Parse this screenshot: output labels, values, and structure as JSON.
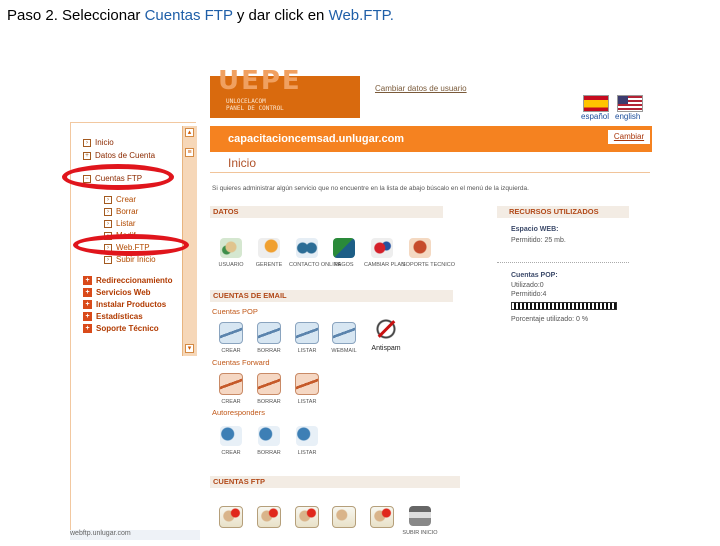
{
  "caption": {
    "part1": "Paso 2. Seleccionar ",
    "part2": "Cuentas FTP",
    "part3": " y dar click en ",
    "part4": "Web.FTP."
  },
  "header": {
    "logo_text": "UEPE",
    "logo_sub1": "UNLOCELACOM",
    "logo_sub2": "PANEL DE CONTROL",
    "change_data_link": "Cambiar datos de usuario",
    "lang_es": "español",
    "lang_en": "english"
  },
  "sidebar": {
    "items": [
      {
        "label": "Inicio"
      },
      {
        "label": "Datos de Cuenta"
      },
      {
        "label": "Cuentas FTP"
      },
      {
        "label": "Crear"
      },
      {
        "label": "Borrar"
      },
      {
        "label": "Listar"
      },
      {
        "label": "Modif."
      },
      {
        "label": "Web.FTP"
      },
      {
        "label": "Subir Inicio"
      },
      {
        "label": "Redireccionamiento"
      },
      {
        "label": "Servicios Web"
      },
      {
        "label": "Instalar Productos"
      },
      {
        "label": "Estadísticas"
      },
      {
        "label": "Soporte Técnico"
      }
    ]
  },
  "main": {
    "domain": "capacitacioncemsad.unlugar.com",
    "change_button": "Cambiar",
    "home_title": "Inicio",
    "intro": "Si quieres administrar algún servicio que no encuentre en la lista de abajo búscalo en el menú de la izquierda.",
    "section_data": "DATOS",
    "data_icons": [
      {
        "label": "USUARIO",
        "icon": "user-icon"
      },
      {
        "label": "GERENTE",
        "icon": "admin-icon"
      },
      {
        "label": "CONTACTO ONLINE",
        "icon": "contact-icon"
      },
      {
        "label": "PAGOS",
        "icon": "payments-icon"
      },
      {
        "label": "CAMBIAR PLAN",
        "icon": "change-plan-icon"
      },
      {
        "label": "SOPORTE TECNICO",
        "icon": "support-icon"
      }
    ],
    "section_email": "CUENTAS DE EMAIL",
    "sub_pop": "Cuentas POP",
    "pop_icons": [
      {
        "label": "CREAR",
        "icon": "mail-create-icon"
      },
      {
        "label": "BORRAR",
        "icon": "mail-delete-icon"
      },
      {
        "label": "LISTAR",
        "icon": "mail-list-icon"
      },
      {
        "label": "WEBMAIL",
        "icon": "webmail-icon"
      },
      {
        "label": "Antispam",
        "icon": "antispam-icon"
      }
    ],
    "sub_forward": "Cuentas Forward",
    "forward_icons": [
      {
        "label": "CREAR",
        "icon": "forward-create-icon"
      },
      {
        "label": "BORRAR",
        "icon": "forward-delete-icon"
      },
      {
        "label": "LISTAR",
        "icon": "forward-list-icon"
      }
    ],
    "sub_auto": "Autoresponders",
    "auto_icons": [
      {
        "label": "CREAR",
        "icon": "auto-create-icon"
      },
      {
        "label": "BORRAR",
        "icon": "auto-delete-icon"
      },
      {
        "label": "LISTAR",
        "icon": "auto-list-icon"
      }
    ],
    "section_ftp": "CUENTAS FTP",
    "ftp_icons": [
      {
        "label": "",
        "icon": "ftp-user-icon"
      },
      {
        "label": "",
        "icon": "ftp-user-icon"
      },
      {
        "label": "",
        "icon": "ftp-user-icon"
      },
      {
        "label": "",
        "icon": "ftp-user-icon"
      },
      {
        "label": "",
        "icon": "ftp-user-icon"
      },
      {
        "label": "SUBIR INICIO",
        "icon": "upload-home-icon"
      }
    ]
  },
  "resources": {
    "title": "RECURSOS UTILIZADOS",
    "web_label": "Espacio WEB:",
    "web_value": "Permitido: 25 mb.",
    "pop_label": "Cuentas POP:",
    "pop_used": "Utilizado:0",
    "pop_allowed": "Permitido:4",
    "quota": "Porcentaje utilizado: 0 %",
    "quota_fraction": 0.0
  },
  "status_bar": "webftp.unlugar.com",
  "colors": {
    "accent": "#f58220",
    "annotation_ring": "#e0151c"
  }
}
